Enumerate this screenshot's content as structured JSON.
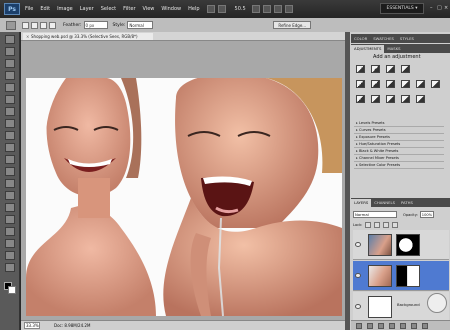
{
  "app": {
    "logo_text": "Ps"
  },
  "menu": {
    "items": [
      "File",
      "Edit",
      "Image",
      "Layer",
      "Select",
      "Filter",
      "View",
      "Window",
      "Help"
    ],
    "zoom_label": "50.5",
    "workspace_label": "ESSENTIALS ▾"
  },
  "options": {
    "feather_label": "Feather:",
    "feather_value": "0 px",
    "style_label": "Style:",
    "style_value": "Normal",
    "refine_label": "Refine Edge..."
  },
  "document": {
    "tab_title": "Shopping web.psd @ 33.3% (Selective Sees, RGB/8*)",
    "status_zoom": "33.3%",
    "status_doc": "Doc: 8.98M/24.2M"
  },
  "adjustments": {
    "tab_active": "ADJUSTMENTS",
    "tab_other": "MASKS",
    "title": "Add an adjustment",
    "presets": [
      "Levels Presets",
      "Curves Presets",
      "Exposure Presets",
      "Hue/Saturation Presets",
      "Black & White Presets",
      "Channel Mixer Presets",
      "Selective Color Presets"
    ]
  },
  "color_tabs": {
    "color": "COLOR",
    "swatches": "SWATCHES",
    "styles": "STYLES"
  },
  "layers": {
    "tab_layers": "LAYERS",
    "tab_channels": "CHANNELS",
    "tab_paths": "PATHS",
    "blend_mode": "Normal",
    "opacity_label": "Opacity:",
    "opacity_value": "100%",
    "lock_label": "Lock:",
    "list": [
      {
        "name": ""
      },
      {
        "name": ""
      },
      {
        "name": "Background"
      }
    ]
  },
  "colors": {
    "selected_layer": "#4f7ad1",
    "panel_bg": "#cfcfcf"
  }
}
